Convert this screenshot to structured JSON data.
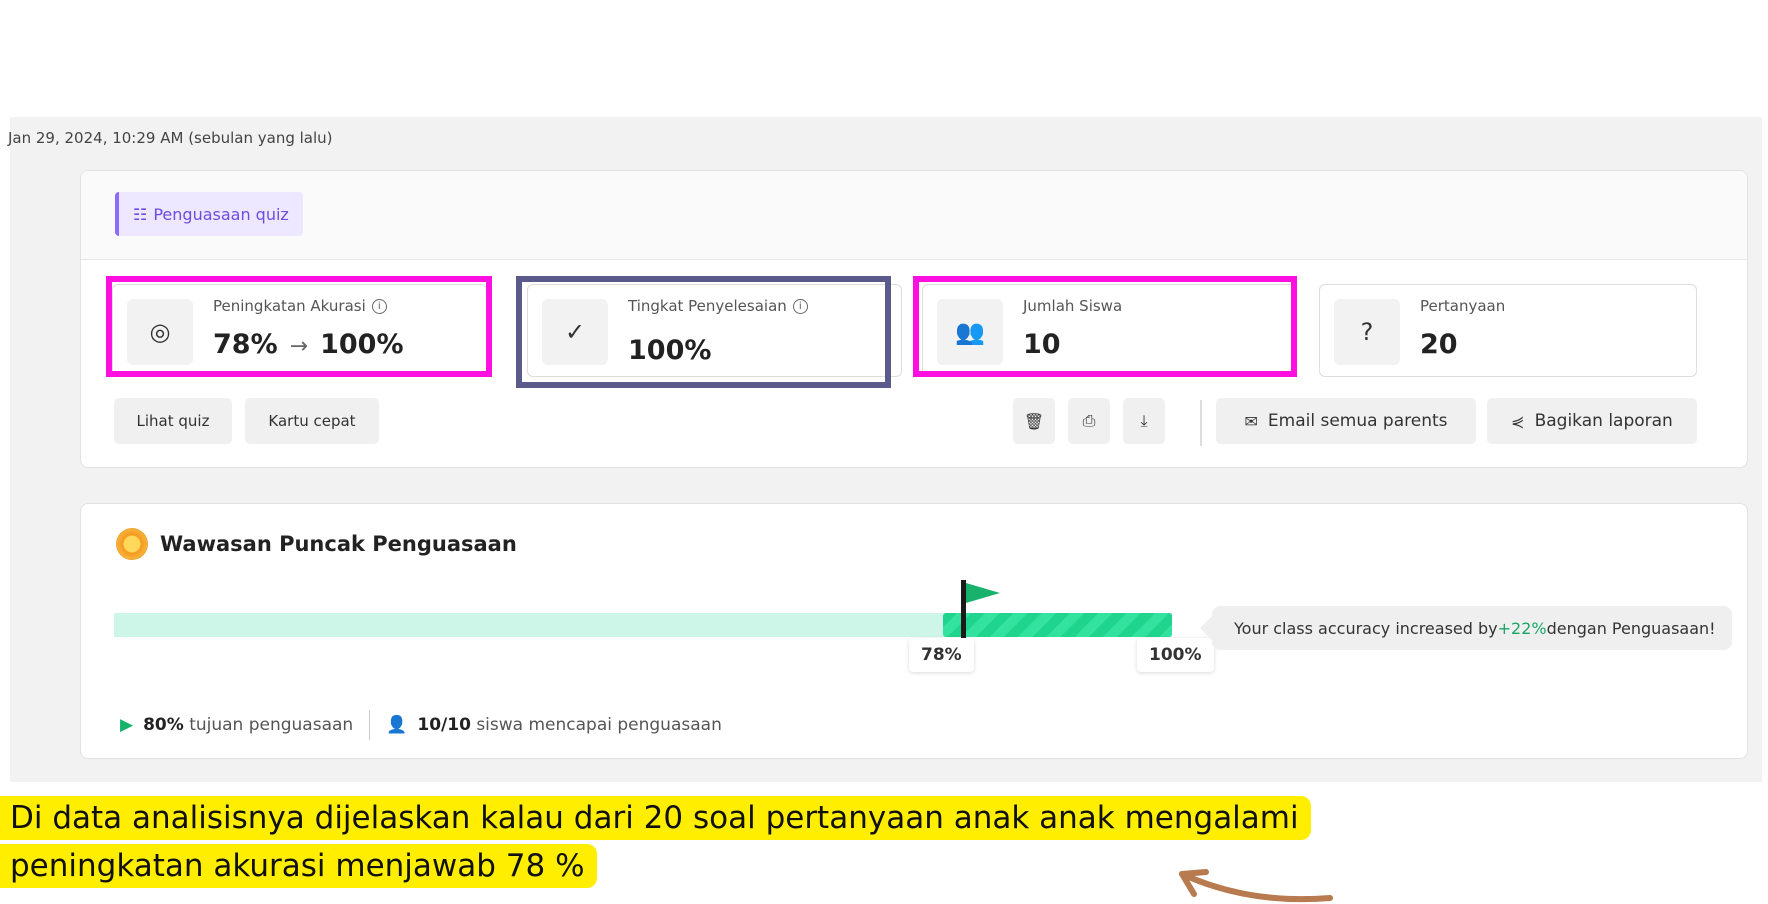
{
  "timestamp": "Jan 29, 2024, 10:29 AM (sebulan yang lalu)",
  "mode_badge": {
    "label": "Penguasaan quiz",
    "icon": "checklist-icon"
  },
  "stats": [
    {
      "label": "Peningkatan Akurasi",
      "from": "78%",
      "arrow": "→",
      "to": "100%",
      "icon": "target-icon",
      "has_info": true
    },
    {
      "label": "Tingkat Penyelesaian",
      "value": "100%",
      "icon": "check-circle-icon",
      "has_info": true
    },
    {
      "label": "Jumlah Siswa",
      "value": "10",
      "icon": "group-icon",
      "has_info": false
    },
    {
      "label": "Pertanyaan",
      "value": "20",
      "icon": "question-circle-icon",
      "has_info": false
    }
  ],
  "actions": {
    "view_quiz": "Lihat quiz",
    "flashcards": "Kartu cepat",
    "email_parents": "Email semua parents",
    "share_report": "Bagikan laporan",
    "delete_icon": "trash-icon",
    "print_icon": "printer-icon",
    "download_icon": "download-icon"
  },
  "insight": {
    "title": "Wawasan Puncak Penguasaan",
    "start_value": "78%",
    "end_value": "100%",
    "start_fraction": 0.78,
    "end_fraction": 1.0,
    "callout_prefix": "Your class accuracy increased by ",
    "callout_pct": "+22%",
    "callout_suffix": " dengan Penguasaan!",
    "goal_value": "80%",
    "goal_text": "tujuan penguasaan",
    "students_value": "10/10",
    "students_text": "siswa mencapai penguasaan"
  },
  "caption": {
    "line1": "Di data analisisnya dijelaskan kalau dari 20 soal pertanyaan anak anak mengalami",
    "line2": "peningkatan akurasi menjawab 78 %"
  },
  "colors": {
    "highlight_magenta": "#ff10e0",
    "highlight_navy": "#5a5b8a",
    "progress_light": "#cdf5e8",
    "progress_fill": "#1fd58e",
    "caption_bg": "#ffee00",
    "arrow": "#b87a4f"
  }
}
